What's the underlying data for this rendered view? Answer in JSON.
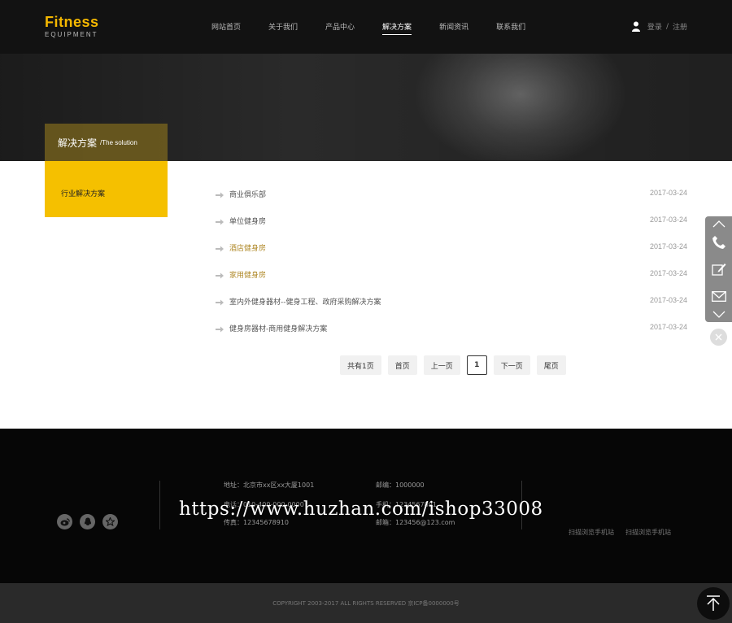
{
  "logo": {
    "title": "Fitness",
    "subtitle": "EQUIPMENT"
  },
  "nav": {
    "items": [
      {
        "label": "网站首页"
      },
      {
        "label": "关于我们"
      },
      {
        "label": "产品中心"
      },
      {
        "label": "解决方案"
      },
      {
        "label": "新闻资讯"
      },
      {
        "label": "联系我们"
      }
    ],
    "active_index": 3
  },
  "account": {
    "login": "登录",
    "separator": "/",
    "register": "注册"
  },
  "sidebar": {
    "title_cn": "解决方案",
    "title_en": "/The solution",
    "link": "行业解决方案"
  },
  "list": {
    "rows": [
      {
        "title": "商业俱乐部",
        "date": "2017-03-24"
      },
      {
        "title": "单位健身房",
        "date": "2017-03-24"
      },
      {
        "title": "酒店健身房",
        "date": "2017-03-24"
      },
      {
        "title": "家用健身房",
        "date": "2017-03-24"
      },
      {
        "title": "室内外健身器材--健身工程、政府采购解决方案",
        "date": "2017-03-24"
      },
      {
        "title": "健身房器材-商用健身解决方案",
        "date": "2017-03-24"
      }
    ]
  },
  "pager": {
    "total": "共有1页",
    "first": "首页",
    "prev": "上一页",
    "current": "1",
    "next": "下一页",
    "last": "尾页"
  },
  "footer": {
    "address": "地址：北京市xx区xx大厦1001",
    "phone": "电话：010-400-000-0000",
    "fax": "传真：12345678910",
    "postcode": "邮编：1000000",
    "mobile": "手机：1234567891",
    "email": "邮箱：123456@123.com",
    "qr1": "扫描浏览手机站",
    "qr2": "扫描浏览手机站",
    "watermark": "https://www.huzhan.com/ishop33008",
    "copyright": "COPYRIGHT 2003-2017 ALL RIGHTS RESERVED 京ICP备0000000号"
  },
  "colors": {
    "accent": "#f5c000",
    "header_bg": "#121212",
    "footer_bg": "#060606"
  },
  "icons": {
    "user": "user-icon",
    "arrow": "arrow-right-icon",
    "phone": "phone-icon",
    "edit": "edit-icon",
    "mail": "mail-icon",
    "chevron_up": "chevron-up-icon",
    "chevron_down": "chevron-down-icon",
    "close": "close-icon",
    "weibo": "weibo-icon",
    "qq": "qq-icon",
    "star": "star-icon",
    "back_to_top": "back-to-top-icon"
  }
}
